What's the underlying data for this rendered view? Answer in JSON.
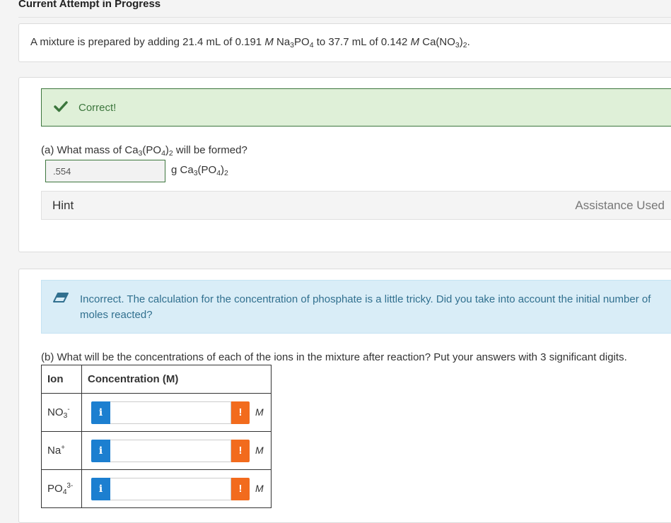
{
  "page": {
    "title": "Current Attempt in Progress"
  },
  "problem": {
    "prompt_pre": "A mixture is prepared by adding 21.4 mL of 0.191 ",
    "prompt_M1": "M",
    "prompt_mid1": " Na",
    "na_sub": "3",
    "prompt_mid2": "PO",
    "po4_sub": "4",
    "prompt_mid3": " to 37.7 mL of 0.142 ",
    "prompt_M2": "M",
    "prompt_mid4": " Ca(NO",
    "no3_sub": "3",
    "prompt_mid5": ")",
    "paren_sub": "2",
    "prompt_end": "."
  },
  "part_a": {
    "feedback": "Correct!",
    "question_pre": "(a) What mass of Ca",
    "q_sub1": "3",
    "question_mid": "(PO",
    "q_sub2": "4",
    "question_mid2": ")",
    "q_sub3": "2",
    "question_end": " will be formed?",
    "answer_value": ".554",
    "unit_pre": "g Ca",
    "unit_sub1": "3",
    "unit_mid": "(PO",
    "unit_sub2": "4",
    "unit_mid2": ")",
    "unit_sub3": "2",
    "hint_label": "Hint",
    "assistance_label": "Assistance Used"
  },
  "part_b": {
    "feedback": "Incorrect. The calculation for the concentration of phosphate is a little tricky. Did you take into account the initial number of moles reacted?",
    "question": "(b) What will be the concentrations of each of the ions in the mixture after reaction? Put your answers with 3 significant digits.",
    "table": {
      "header_ion": "Ion",
      "header_conc": "Concentration (M)",
      "rows": [
        {
          "ion_base": "NO",
          "ion_sub": "3",
          "ion_sup": "-",
          "value": "",
          "unit": "M"
        },
        {
          "ion_base": "Na",
          "ion_sub": "",
          "ion_sup": "+",
          "value": "",
          "unit": "M"
        },
        {
          "ion_base": "PO",
          "ion_sub": "4",
          "ion_sup": "3-",
          "value": "",
          "unit": "M"
        }
      ]
    },
    "info_glyph": "i",
    "warn_glyph": "!"
  },
  "colors": {
    "correct_bg": "#dff0d8",
    "correct_text": "#3c763d",
    "incorrect_bg": "#d9edf7",
    "incorrect_text": "#31708f",
    "info_blue": "#1c7fd0",
    "warn_orange": "#f26b1d"
  },
  "icons": {
    "correct": "checkmark-icon",
    "incorrect": "eraser-icon",
    "info": "info-icon",
    "warning": "exclamation-icon"
  }
}
